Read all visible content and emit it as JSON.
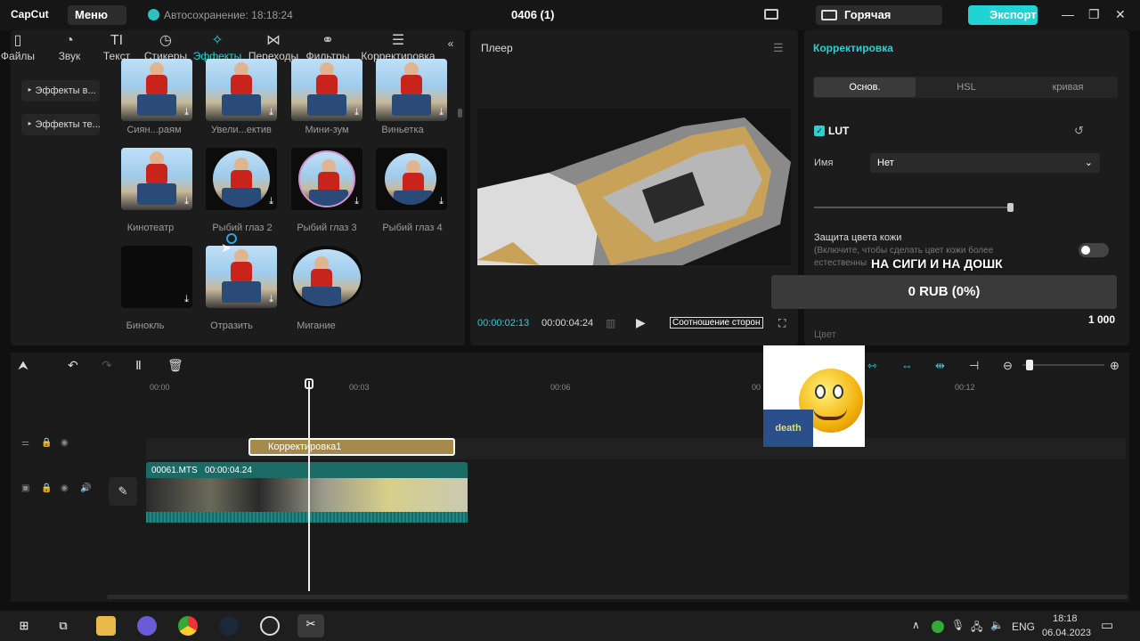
{
  "app": {
    "logo": "CapCut",
    "menu": "Меню",
    "autosave": "Автосохранение: 18:18:24",
    "project": "0406 (1)",
    "hotkey": "Горячая клавиша",
    "export": "Экспорт"
  },
  "tabs": [
    {
      "label": "Файлы",
      "icon": "files-icon"
    },
    {
      "label": "Звук",
      "icon": "audio-icon"
    },
    {
      "label": "Текст",
      "icon": "text-icon"
    },
    {
      "label": "Стикеры",
      "icon": "sticker-icon"
    },
    {
      "label": "Эффекты",
      "icon": "effects-icon",
      "active": true
    },
    {
      "label": "Переходы",
      "icon": "transition-icon"
    },
    {
      "label": "Фильтры",
      "icon": "filter-icon"
    },
    {
      "label": "Корректировка",
      "icon": "adjust-icon"
    }
  ],
  "sidebar": [
    "Эффекты в...",
    "Эффекты те..."
  ],
  "effects": [
    "Сиян...раям",
    "Увели...ектив",
    "Мини-зум",
    "Виньетка",
    "Кинотеатр",
    "Рыбий глаз 2",
    "Рыбий глаз 3",
    "Рыбий глаз 4",
    "Бинокль",
    "Отразить",
    "Мигание"
  ],
  "player": {
    "title": "Плеер",
    "current": "00:00:02:13",
    "total": "00:00:04:24",
    "ratio": "Соотношение сторон"
  },
  "correction": {
    "title": "Корректировка",
    "segments": [
      "Основ.",
      "HSL",
      "кривая"
    ],
    "lut": "LUT",
    "name_label": "Имя",
    "name_value": "Нет",
    "skin_title": "Защита цвета кожи",
    "skin_desc": "(Включите, чтобы сделать цвет кожи более естественны",
    "color_label": "Цвет"
  },
  "overlay": {
    "banner": "НА СИГИ И НА ДОШК",
    "donation": "0 RUB (0%)",
    "amount": "1 000",
    "sticker": "death"
  },
  "timeline": {
    "ticks": [
      "00:00",
      "00:03",
      "00:06",
      "00",
      "00:12"
    ],
    "adjust_clip": "Корректировка1",
    "video_clip": "00061.MTS",
    "video_duration": "00:00:04.24"
  },
  "taskbar": {
    "lang": "ENG",
    "time": "18:18",
    "date": "06.04.2023"
  }
}
